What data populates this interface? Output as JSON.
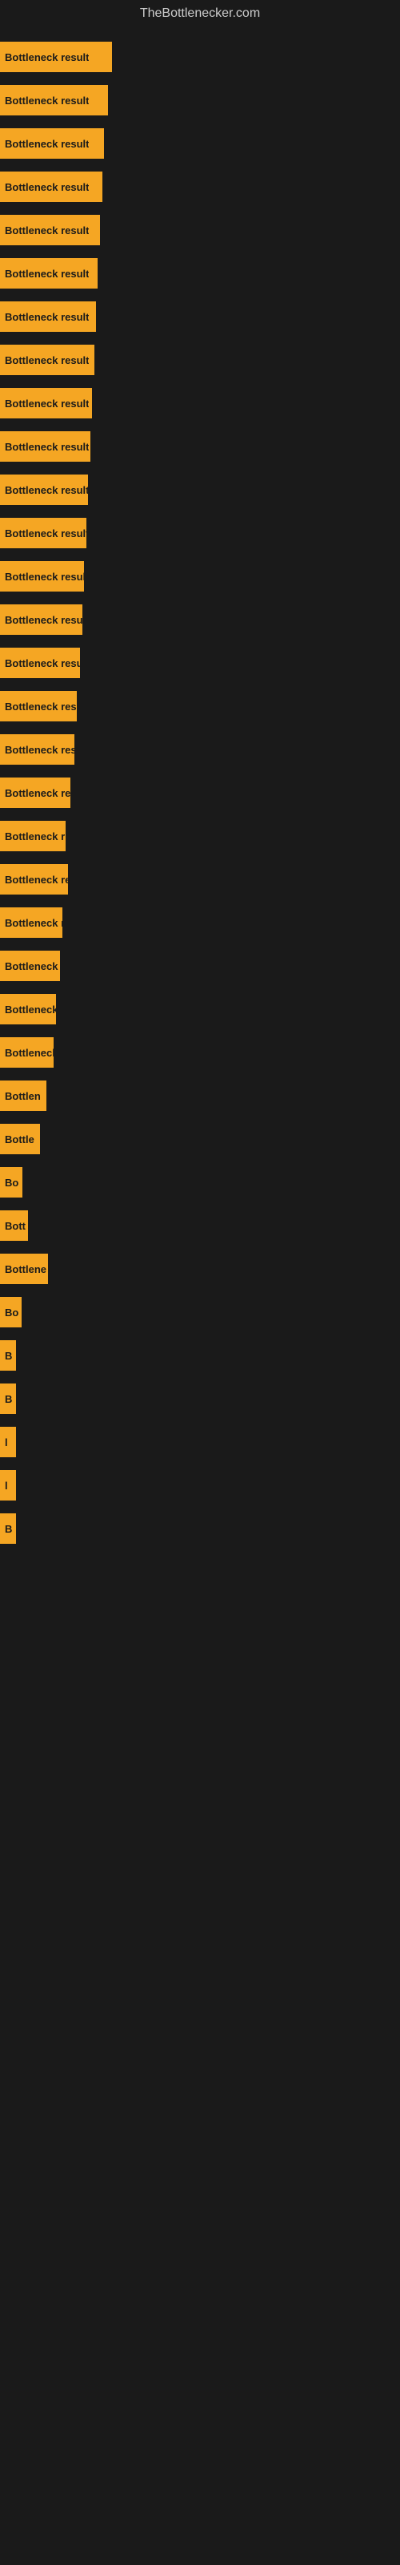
{
  "site": {
    "title": "TheBottlenecker.com"
  },
  "bars": [
    {
      "label": "Bottleneck result",
      "width": 140
    },
    {
      "label": "Bottleneck result",
      "width": 135
    },
    {
      "label": "Bottleneck result",
      "width": 130
    },
    {
      "label": "Bottleneck result",
      "width": 128
    },
    {
      "label": "Bottleneck result",
      "width": 125
    },
    {
      "label": "Bottleneck result",
      "width": 122
    },
    {
      "label": "Bottleneck result",
      "width": 120
    },
    {
      "label": "Bottleneck result",
      "width": 118
    },
    {
      "label": "Bottleneck result",
      "width": 115
    },
    {
      "label": "Bottleneck result",
      "width": 113
    },
    {
      "label": "Bottleneck result",
      "width": 110
    },
    {
      "label": "Bottleneck result",
      "width": 108
    },
    {
      "label": "Bottleneck result",
      "width": 105
    },
    {
      "label": "Bottleneck result",
      "width": 103
    },
    {
      "label": "Bottleneck result",
      "width": 100
    },
    {
      "label": "Bottleneck resul",
      "width": 96
    },
    {
      "label": "Bottleneck result",
      "width": 93
    },
    {
      "label": "Bottleneck resu",
      "width": 88
    },
    {
      "label": "Bottleneck r",
      "width": 82
    },
    {
      "label": "Bottleneck resu",
      "width": 85
    },
    {
      "label": "Bottleneck re",
      "width": 78
    },
    {
      "label": "Bottleneck result",
      "width": 75
    },
    {
      "label": "Bottleneck",
      "width": 70
    },
    {
      "label": "Bottleneck res",
      "width": 67
    },
    {
      "label": "Bottlen",
      "width": 58
    },
    {
      "label": "Bottle",
      "width": 50
    },
    {
      "label": "Bo",
      "width": 28
    },
    {
      "label": "Bott",
      "width": 35
    },
    {
      "label": "Bottlene",
      "width": 60
    },
    {
      "label": "Bo",
      "width": 27
    },
    {
      "label": "B",
      "width": 14
    },
    {
      "label": "B",
      "width": 18
    },
    {
      "label": "l",
      "width": 8
    },
    {
      "label": "l",
      "width": 8
    },
    {
      "label": "B",
      "width": 18
    }
  ]
}
